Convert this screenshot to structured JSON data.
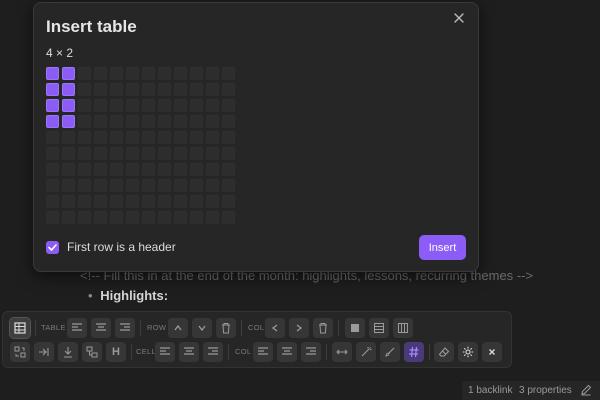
{
  "editor": {
    "comment": "<!-- Fill this in at the end of the month: highlights, lessons, recurring themes -->",
    "bullet_label": "Highlights:",
    "bullet_glyph": "•"
  },
  "dialog": {
    "title": "Insert table",
    "size_label": "4 × 2",
    "grid": {
      "columns": 12,
      "rows": 10,
      "selected_rows": 4,
      "selected_columns": 2
    },
    "header_checkbox_label": "First row is a header",
    "header_checked": true,
    "insert_label": "Insert",
    "close_icon": "close-icon"
  },
  "toolbar": {
    "table_label": "TABLE",
    "row_label": "ROW",
    "col_label": "COL",
    "cell_label": "CELL",
    "col2_label": "COL",
    "heading_glyph": "H"
  },
  "status": {
    "backlinks": "1 backlink",
    "properties": "3 properties"
  },
  "colors": {
    "accent": "#8b5cf6",
    "background": "#1e1e1e",
    "panel": "#262626"
  }
}
